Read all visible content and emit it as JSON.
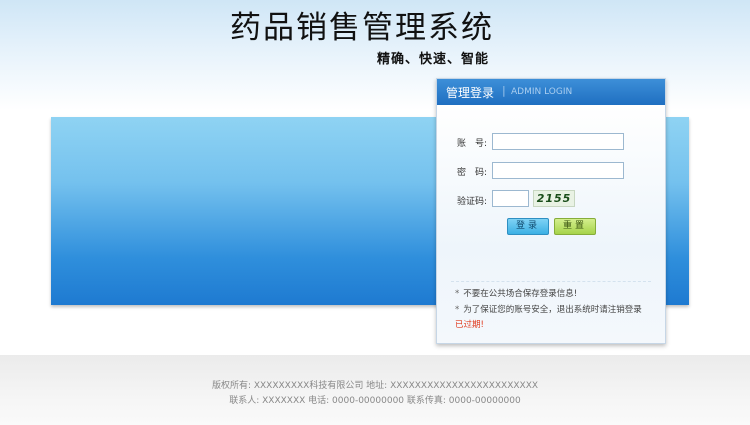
{
  "header": {
    "title": "药品销售管理系统",
    "subtitle": "精确、快速、智能"
  },
  "login": {
    "title": "管理登录",
    "separator": "|",
    "title_en": "ADMIN LOGIN",
    "account_label": "账　号:",
    "account_value": "",
    "password_label": "密　码:",
    "password_value": "",
    "captcha_label": "验证码:",
    "captcha_value": "",
    "captcha_text": "2155",
    "login_button": "登录",
    "reset_button": "重置",
    "notes": [
      "不要在公共场合保存登录信息!",
      "为了保证您的账号安全，退出系统时请注销登录"
    ],
    "note_bullet": "*",
    "expired": "已过期!"
  },
  "footer": {
    "line1": "版权所有: XXXXXXXXX科技有限公司  地址: XXXXXXXXXXXXXXXXXXXXXXXX",
    "line2": "联系人: XXXXXXX  电话: 0000-00000000  联系传真: 0000-00000000"
  },
  "colors": {
    "header_blue": "#1f6fc1",
    "banner_blue": "#2f8fdc",
    "login_button": "#3cb0e4",
    "reset_button": "#a6d34a",
    "expired_red": "#e03a1e"
  }
}
